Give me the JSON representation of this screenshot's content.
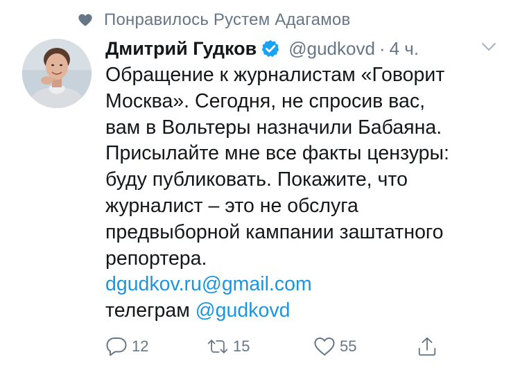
{
  "social_context": {
    "icon": "heart-icon",
    "text": "Понравилось Рустем Адагамов"
  },
  "author": {
    "name": "Дмитрий Гудков",
    "verified_icon": "verified-badge-icon",
    "handle": "@gudkovd",
    "separator": "·",
    "time": "4 ч."
  },
  "tweet": {
    "lines": [
      "Обращение к журналистам «Говорит",
      "Москва». Сегодня, не спросив вас,",
      "вам в Вольтеры назначили Бабаяна.",
      "Присылайте мне все факты цензуры:",
      "буду публиковать. Покажите, что",
      "журналист – это не обслуга",
      "предвыборной кампании заштатного",
      "репортера."
    ],
    "email_link": "dgudkov.ru@gmail.com",
    "telegram_prefix": "телеграм",
    "telegram_link": "@gudkovd"
  },
  "actions": {
    "reply_count": "12",
    "retweet_count": "15",
    "like_count": "55"
  },
  "colors": {
    "text": "#14171a",
    "secondary": "#657786",
    "link": "#1b95e0",
    "verified": "#1da1f2"
  }
}
